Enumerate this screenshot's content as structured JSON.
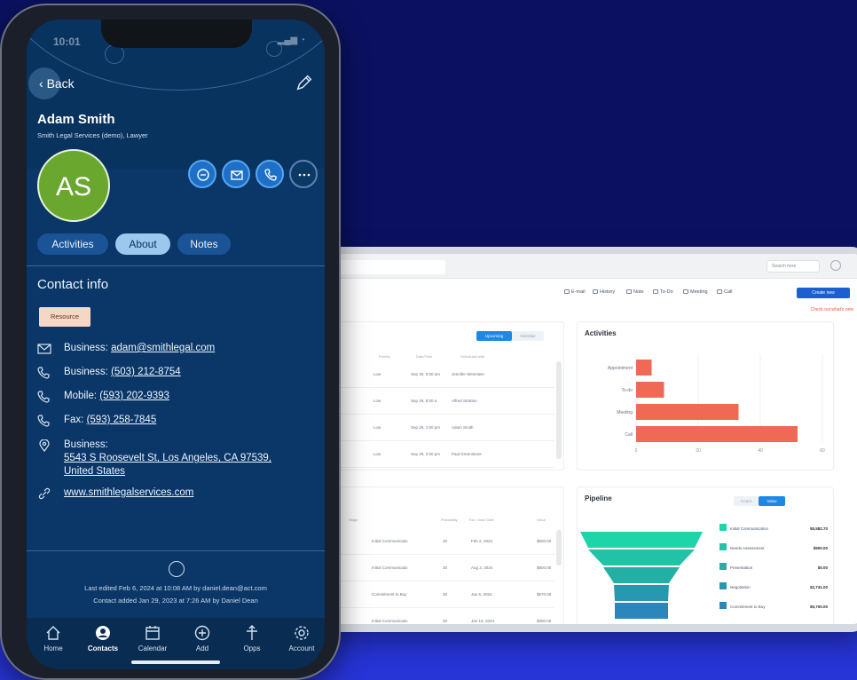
{
  "phone": {
    "status": {
      "time": "10:01"
    },
    "header": {
      "back_label": "Back"
    },
    "contact": {
      "name": "Adam Smith",
      "subtitle": "Smith Legal Services (demo), Lawyer",
      "initials": "AS"
    },
    "tabs": [
      {
        "label": "Activities"
      },
      {
        "label": "About",
        "active": true
      },
      {
        "label": "Notes"
      }
    ],
    "section_title": "Contact info",
    "badge": "Resource",
    "info": {
      "email_label": "Business:",
      "email_value": "adam@smithlegal.com",
      "phone1_label": "Business:",
      "phone1_value": "(503) 212-8754",
      "phone2_label": "Mobile:",
      "phone2_value": "(593) 202-9393",
      "phone3_label": "Fax:",
      "phone3_value": "(593) 258-7845",
      "address_label": "Business:",
      "address_line1": "5543 S Roosevelt St, Los Angeles, CA 97539,",
      "address_line2": "United States",
      "website": "www.smithlegalservices.com"
    },
    "footer": {
      "edited": "Last edited Feb 6, 2024 at 10:08 AM by daniel.dean@act.com",
      "added": "Contact added Jan 29, 2023 at 7:26 AM by Daniel Dean"
    },
    "nav": [
      {
        "label": "Home",
        "icon": "home-icon"
      },
      {
        "label": "Contacts",
        "icon": "contacts-icon",
        "active": true
      },
      {
        "label": "Calendar",
        "icon": "calendar-icon"
      },
      {
        "label": "Add",
        "icon": "add-icon"
      },
      {
        "label": "Opps",
        "icon": "opps-icon"
      },
      {
        "label": "Account",
        "icon": "settings-icon"
      }
    ]
  },
  "desktop": {
    "search_label": "Search here",
    "toolbar": {
      "email": "E-mail",
      "history": "History",
      "note": "Note",
      "todo": "To-Do",
      "meeting": "Meeting",
      "call": "Call",
      "create": "Create new"
    },
    "check_link": "Check out what's new",
    "toggles": {
      "upcoming": "Upcoming",
      "overdue": "Overdue",
      "count": "Count",
      "value": "Value"
    },
    "activities_table": {
      "headers": [
        "Priority",
        "Date/Time",
        "Scheduled with"
      ],
      "rows": [
        [
          "Low",
          "Sep 30, 9:00 am",
          "Jennifer Weinstein"
        ],
        [
          "Low",
          "Sep 29, 8:00 a",
          "Alfred Stratton"
        ],
        [
          "Low",
          "Sep 29, 1:00 pm",
          "Adam Smith"
        ],
        [
          "Low",
          "Sep 29, 2:00 pm",
          "Paul Greenstone"
        ]
      ]
    },
    "opps_table": {
      "headers": [
        "Stage",
        "Probability",
        "Est. Close Date",
        "Value"
      ],
      "rows": [
        [
          "Initial Communicatio",
          "30",
          "Feb 2, 2024",
          "$500.00"
        ],
        [
          "Initial Communicatio",
          "30",
          "Aug 3, 2024",
          "$500.00"
        ],
        [
          "Commitment to Buy",
          "30",
          "Jan 6, 2024",
          "$570.00"
        ],
        [
          "Initial Communicatio",
          "30",
          "Jan 19, 2024",
          "$300.00"
        ]
      ]
    },
    "activities_chart": {
      "title": "Activities",
      "accent": "#ee6a55"
    },
    "pipeline_chart": {
      "title": "Pipeline",
      "legend": [
        {
          "label": "Initial Communication",
          "value": "$5,582.70"
        },
        {
          "label": "Needs Assessment",
          "value": "$900.00"
        },
        {
          "label": "Presentation",
          "value": "$0.00"
        },
        {
          "label": "Negotiation",
          "value": "$2,741.00"
        },
        {
          "label": "Commitment to Buy",
          "value": "$5,700.00"
        }
      ]
    }
  },
  "chart_data": [
    {
      "type": "bar",
      "orientation": "horizontal",
      "title": "Activities",
      "categories": [
        "Appointment",
        "To-do",
        "Meeting",
        "Call"
      ],
      "values": [
        5,
        9,
        33,
        52
      ],
      "xlim": [
        0,
        60
      ],
      "xticks": [
        "0",
        "20",
        "40",
        "60"
      ]
    },
    {
      "type": "funnel",
      "title": "Pipeline",
      "categories": [
        "Initial Communication",
        "Needs Assessment",
        "Presentation",
        "Negotiation",
        "Commitment to Buy"
      ],
      "values": [
        5582.7,
        900.0,
        0.0,
        2741.0,
        5700.0
      ]
    }
  ]
}
